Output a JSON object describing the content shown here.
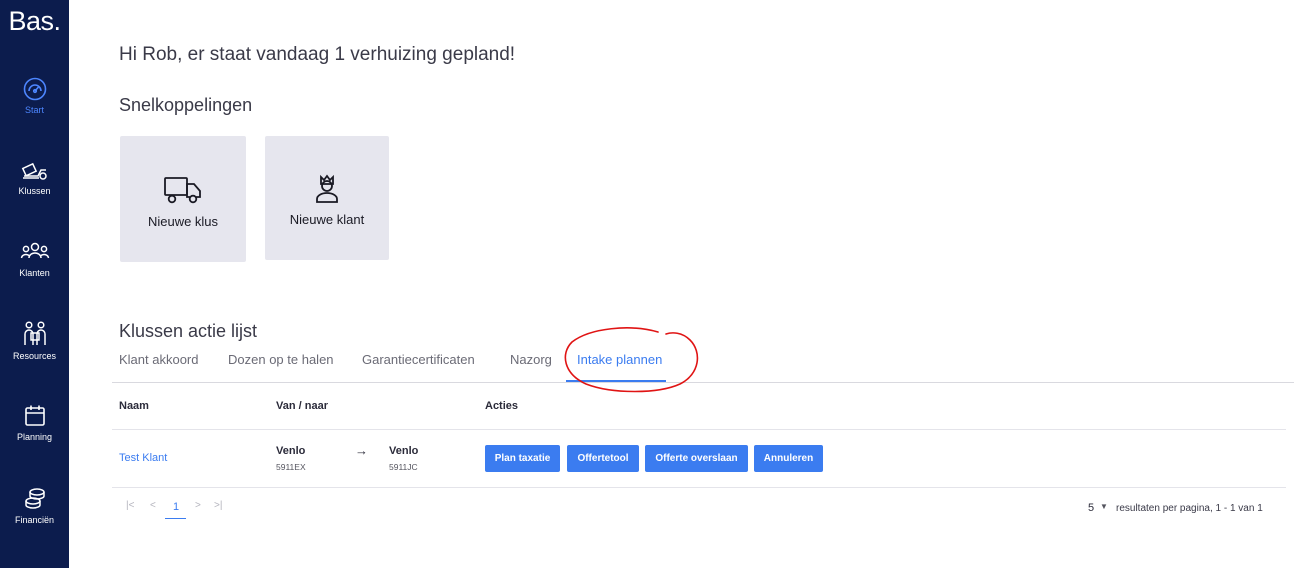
{
  "app": {
    "logo": "Bas."
  },
  "sidebar": {
    "items": [
      {
        "label": "Start",
        "icon": "dashboard-gauge-icon",
        "active": true
      },
      {
        "label": "Klussen",
        "icon": "moving-jobs-icon"
      },
      {
        "label": "Klanten",
        "icon": "customers-group-icon"
      },
      {
        "label": "Resources",
        "icon": "movers-people-icon"
      },
      {
        "label": "Planning",
        "icon": "calendar-icon"
      },
      {
        "label": "Financiën",
        "icon": "coins-stack-icon"
      }
    ]
  },
  "main": {
    "greeting": "Hi Rob, er staat vandaag 1 verhuizing gepland!",
    "shortcuts_title": "Snelkoppelingen",
    "shortcuts": [
      {
        "label": "Nieuwe klus",
        "icon": "truck-icon"
      },
      {
        "label": "Nieuwe klant",
        "icon": "person-crown-icon"
      }
    ],
    "actions_title": "Klussen actie lijst",
    "tabs": [
      {
        "label": "Klant akkoord"
      },
      {
        "label": "Dozen op te halen"
      },
      {
        "label": "Garantiecertificaten"
      },
      {
        "label": "Nazorg"
      },
      {
        "label": "Intake plannen",
        "active": true
      }
    ],
    "table": {
      "headers": {
        "name": "Naam",
        "route": "Van / naar",
        "actions": "Acties"
      },
      "rows": [
        {
          "name": "Test Klant",
          "from_city": "Venlo",
          "from_zip": "5911EX",
          "arrow": "→",
          "to_city": "Venlo",
          "to_zip": "5911JC",
          "buttons": [
            "Plan taxatie",
            "Offertetool",
            "Offerte overslaan",
            "Annuleren"
          ]
        }
      ]
    },
    "pagination": {
      "first": "|<",
      "prev": "<",
      "current_page": "1",
      "next": ">",
      "last": ">|",
      "per_page": "5",
      "results_text": "resultaten per pagina, 1 - 1 van 1"
    }
  },
  "colors": {
    "sidebar_bg": "#0c1c4d",
    "accent": "#3b7cf0",
    "shortcut_bg": "#e6e6ee",
    "annotation": "#e01414"
  }
}
